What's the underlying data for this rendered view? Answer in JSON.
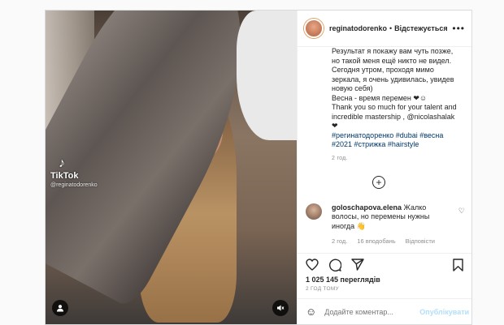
{
  "account": {
    "username": "reginatodorenko",
    "follow_label": "Відстежується"
  },
  "tiktok": {
    "label": "TikTok",
    "handle": "@reginatodorenko"
  },
  "caption": {
    "line1": "Результат я покажу вам чуть позже,",
    "line2": "но такой меня ещё никто не видел.",
    "line3": "Сегодня утром, проходя мимо",
    "line4": "зеркала, я очень удивилась, увидев",
    "line5": "новую себя)",
    "line6": "Весна - время перемен ❤☺",
    "line7": "Thank you so much for your talent and",
    "line8": "incredible mastership , @nicolashalak",
    "line9": "❤",
    "tags1": "#регинатодоренко #dubai #весна",
    "tags2": "#2021 #стрижка #hairstyle",
    "time": "2 год."
  },
  "comment": {
    "author": "goloschapova.elena",
    "text": "Жалко волосы, но перемены нужны иногда 👋",
    "time": "2 год.",
    "likes": "16 вподобань",
    "reply": "Відповісти"
  },
  "likes_count": "1 025 145 переглядів",
  "posted_ago": "2 ГОД ТОМУ",
  "add_comment": {
    "placeholder": "Додайте коментар...",
    "publish_label": "Опублікувати"
  }
}
